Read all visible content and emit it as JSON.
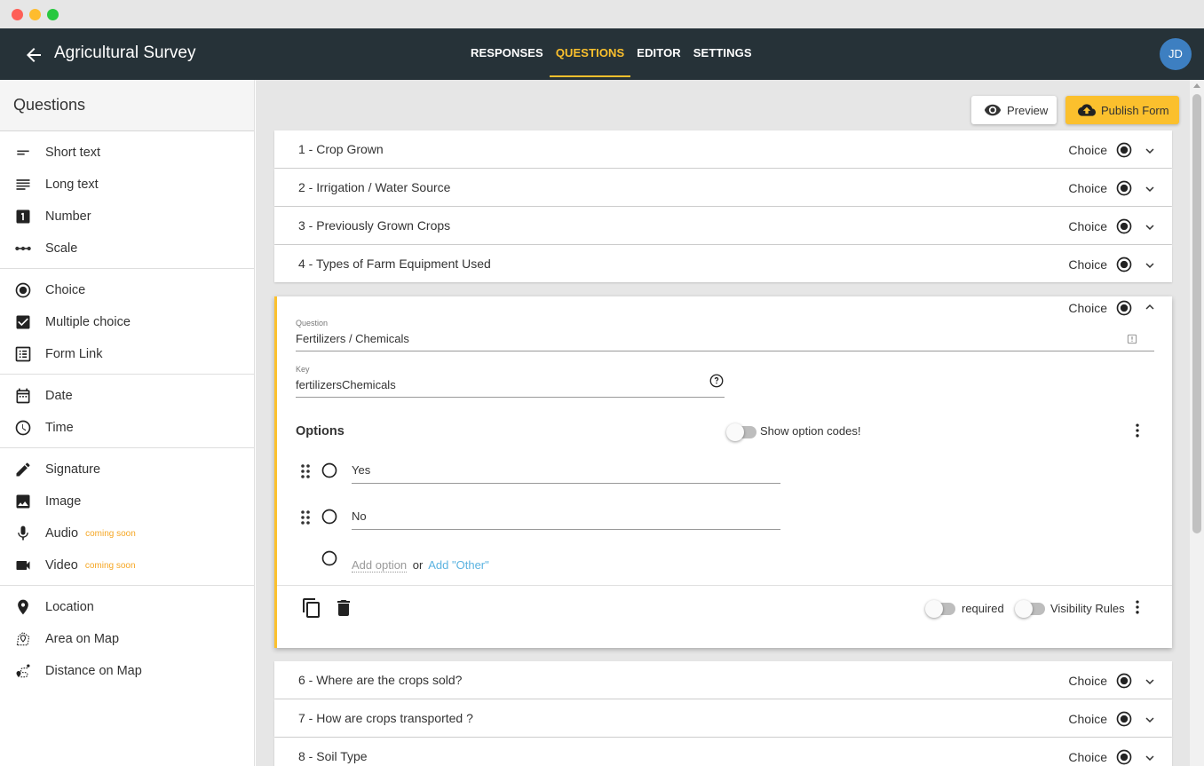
{
  "app": {
    "title": "Agricultural Survey",
    "avatar_initials": "JD",
    "accent_color": "#fbc02d",
    "header_color": "#263238"
  },
  "tabs": [
    {
      "label": "RESPONSES",
      "active": false
    },
    {
      "label": "QUESTIONS",
      "active": true
    },
    {
      "label": "EDITOR",
      "active": false
    },
    {
      "label": "SETTINGS",
      "active": false
    }
  ],
  "sidebar": {
    "title": "Questions",
    "items": [
      {
        "label": "Short text",
        "icon": "short-text-icon"
      },
      {
        "label": "Long text",
        "icon": "long-text-icon"
      },
      {
        "label": "Number",
        "icon": "number-icon"
      },
      {
        "label": "Scale",
        "icon": "scale-icon"
      },
      {
        "label": "Choice",
        "icon": "radio-icon"
      },
      {
        "label": "Multiple choice",
        "icon": "checkbox-icon"
      },
      {
        "label": "Form Link",
        "icon": "form-link-icon"
      },
      {
        "label": "Date",
        "icon": "calendar-icon"
      },
      {
        "label": "Time",
        "icon": "clock-icon"
      },
      {
        "label": "Signature",
        "icon": "pencil-icon"
      },
      {
        "label": "Image",
        "icon": "image-icon"
      },
      {
        "label": "Audio",
        "icon": "microphone-icon",
        "badge": "coming soon"
      },
      {
        "label": "Video",
        "icon": "video-camera-icon",
        "badge": "coming soon"
      },
      {
        "label": "Location",
        "icon": "map-pin-icon"
      },
      {
        "label": "Area on Map",
        "icon": "map-area-icon"
      },
      {
        "label": "Distance on Map",
        "icon": "route-icon"
      }
    ]
  },
  "toolbar": {
    "preview_label": "Preview",
    "publish_label": "Publish Form"
  },
  "questions": [
    {
      "label": "1 - Crop Grown",
      "type": "Choice"
    },
    {
      "label": "2 - Irrigation / Water Source",
      "type": "Choice"
    },
    {
      "label": "3 - Previously Grown Crops",
      "type": "Choice"
    },
    {
      "label": "4 - Types of Farm Equipment Used",
      "type": "Choice"
    },
    {
      "label": "6 - Where are the crops sold?",
      "type": "Choice"
    },
    {
      "label": "7 - How are crops transported ?",
      "type": "Choice"
    },
    {
      "label": "8 - Soil Type",
      "type": "Choice"
    }
  ],
  "expanded_question": {
    "type": "Choice",
    "question_label": "Question",
    "question_value": "Fertilizers / Chemicals",
    "key_label": "Key",
    "key_value": "fertilizersChemicals",
    "options_title": "Options",
    "show_codes_label": "Show option codes!",
    "options": [
      "Yes",
      "No"
    ],
    "add_option_label": "Add option",
    "or_label": "or",
    "add_other_label": "Add \"Other\"",
    "required_label": "required",
    "visibility_label": "Visibility Rules"
  }
}
